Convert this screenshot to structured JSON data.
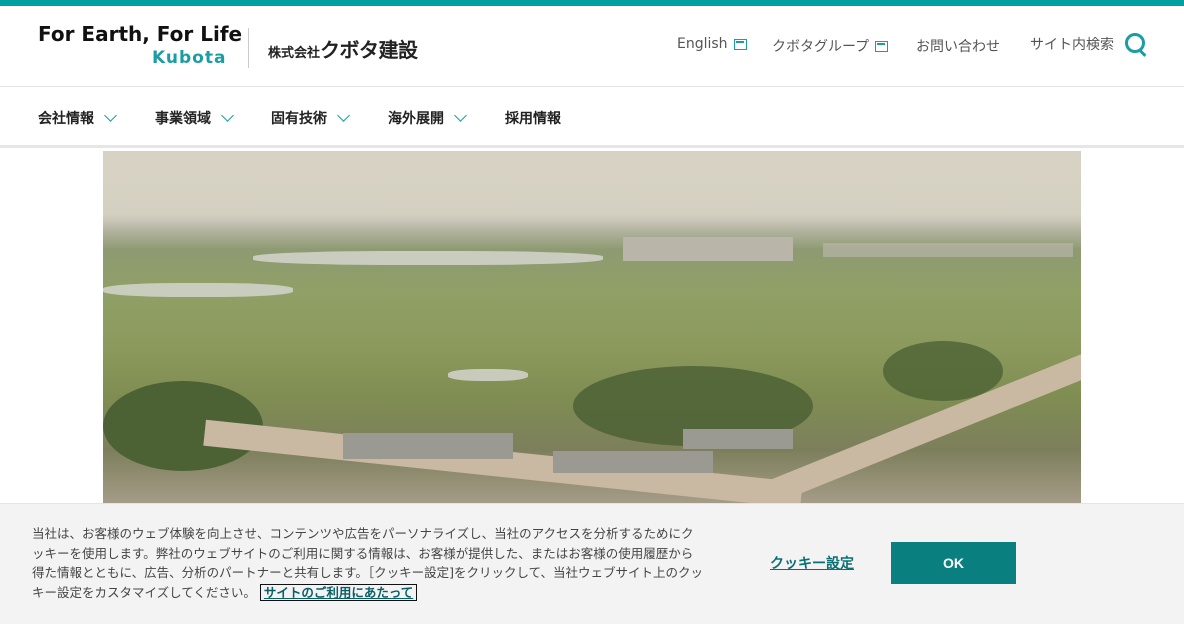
{
  "header": {
    "tagline": "For Earth, For Life",
    "brand": "Kubota",
    "company_prefix": "株式会社",
    "company_name": "クボタ建設",
    "utility_links": [
      {
        "label": "English",
        "icon": "external-window-icon"
      },
      {
        "label": "クボタグループ",
        "icon": "external-window-icon"
      },
      {
        "label": "お問い合わせ"
      },
      {
        "label": "サイト内検索",
        "icon": "search-icon"
      }
    ]
  },
  "nav": {
    "items": [
      {
        "label": "会社情報",
        "has_dropdown": true
      },
      {
        "label": "事業領域",
        "has_dropdown": true
      },
      {
        "label": "固有技術",
        "has_dropdown": true
      },
      {
        "label": "海外展開",
        "has_dropdown": true
      },
      {
        "label": "採用情報",
        "has_dropdown": false
      }
    ]
  },
  "cookie": {
    "text": "当社は、お客様のウェブ体験を向上させ、コンテンツや広告をパーソナライズし、当社のアクセスを分析するためにクッキーを使用します。弊社のウェブサイトのご利用に関する情報は、お客様が提供した、またはお客様の使用履歴から得た情報とともに、広告、分析のパートナーと共有します。［クッキー設定]をクリックして、当社ウェブサイト上のクッキー設定をカスタマイズしてください。",
    "terms_link": "サイトのご利用にあたって",
    "settings_label": "クッキー設定",
    "ok_label": "OK"
  },
  "colors": {
    "accent": "#1a9ea3",
    "ok_button": "#0a7f80",
    "top_bar": "#00a0a0"
  }
}
